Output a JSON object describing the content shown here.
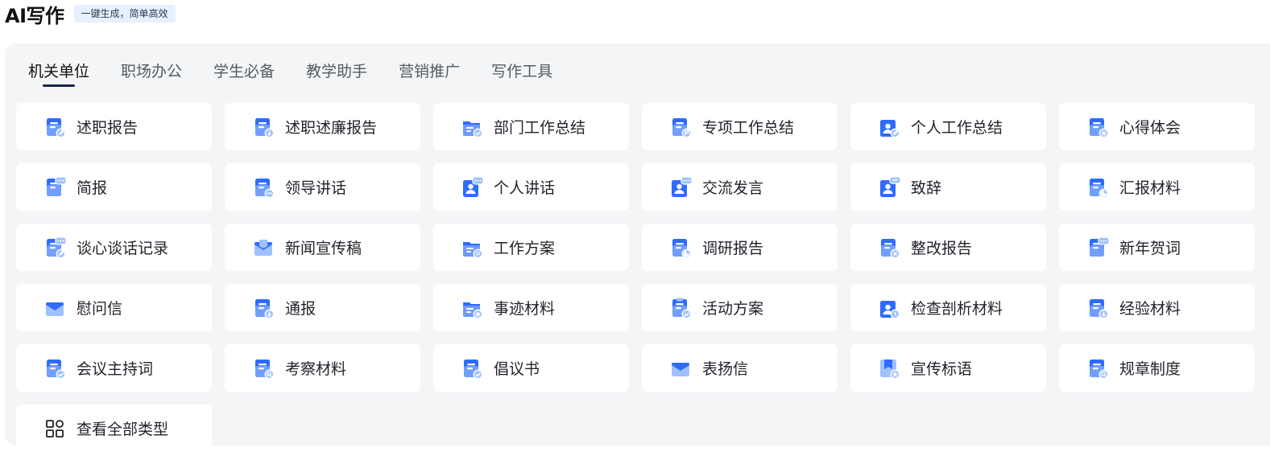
{
  "header": {
    "title": "AI写作",
    "tagline": "一键生成，简单高效"
  },
  "tabs": [
    {
      "label": "机关单位",
      "active": true
    },
    {
      "label": "职场办公",
      "active": false
    },
    {
      "label": "学生必备",
      "active": false
    },
    {
      "label": "教学助手",
      "active": false
    },
    {
      "label": "营销推广",
      "active": false
    },
    {
      "label": "写作工具",
      "active": false
    }
  ],
  "colors": {
    "icon_primary": "#2f6bff",
    "icon_light": "#9fc1ff",
    "tab_underline": "#16254a",
    "tagline_bg": "#e6f0ff",
    "panel_bg": "#f4f5f7"
  },
  "templates": [
    {
      "label": "述职报告",
      "icon": "pen-document-icon"
    },
    {
      "label": "述职述廉报告",
      "icon": "download-document-icon"
    },
    {
      "label": "部门工作总结",
      "icon": "check-folder-icon"
    },
    {
      "label": "专项工作总结",
      "icon": "flag-document-icon"
    },
    {
      "label": "个人工作总结",
      "icon": "user-edit-icon"
    },
    {
      "label": "心得体会",
      "icon": "star-document-icon"
    },
    {
      "label": "简报",
      "icon": "chat-document-icon"
    },
    {
      "label": "领导讲话",
      "icon": "more-document-icon"
    },
    {
      "label": "个人讲话",
      "icon": "user-chat-icon"
    },
    {
      "label": "交流发言",
      "icon": "user-chat-icon"
    },
    {
      "label": "致辞",
      "icon": "user-message-icon"
    },
    {
      "label": "汇报材料",
      "icon": "chart-document-icon"
    },
    {
      "label": "谈心谈话记录",
      "icon": "pen-chat-icon"
    },
    {
      "label": "新闻宣传稿",
      "icon": "mail-icon"
    },
    {
      "label": "工作方案",
      "icon": "list-folder-icon"
    },
    {
      "label": "调研报告",
      "icon": "pie-chart-document-icon"
    },
    {
      "label": "整改报告",
      "icon": "close-document-icon"
    },
    {
      "label": "新年贺词",
      "icon": "chat-document-icon"
    },
    {
      "label": "慰问信",
      "icon": "envelope-icon"
    },
    {
      "label": "通报",
      "icon": "download-document-icon"
    },
    {
      "label": "事迹材料",
      "icon": "star-folder-icon"
    },
    {
      "label": "活动方案",
      "icon": "check-clipboard-icon"
    },
    {
      "label": "检查剖析材料",
      "icon": "user-clock-icon"
    },
    {
      "label": "经验材料",
      "icon": "download-document-icon"
    },
    {
      "label": "会议主持词",
      "icon": "check-document-icon"
    },
    {
      "label": "考察材料",
      "icon": "search-document-icon"
    },
    {
      "label": "倡议书",
      "icon": "check-document-icon"
    },
    {
      "label": "表扬信",
      "icon": "envelope-icon"
    },
    {
      "label": "宣传标语",
      "icon": "bookmark-star-icon"
    },
    {
      "label": "规章制度",
      "icon": "search-document-icon"
    }
  ],
  "view_all": {
    "label": "查看全部类型",
    "icon": "grid-apps-icon"
  }
}
